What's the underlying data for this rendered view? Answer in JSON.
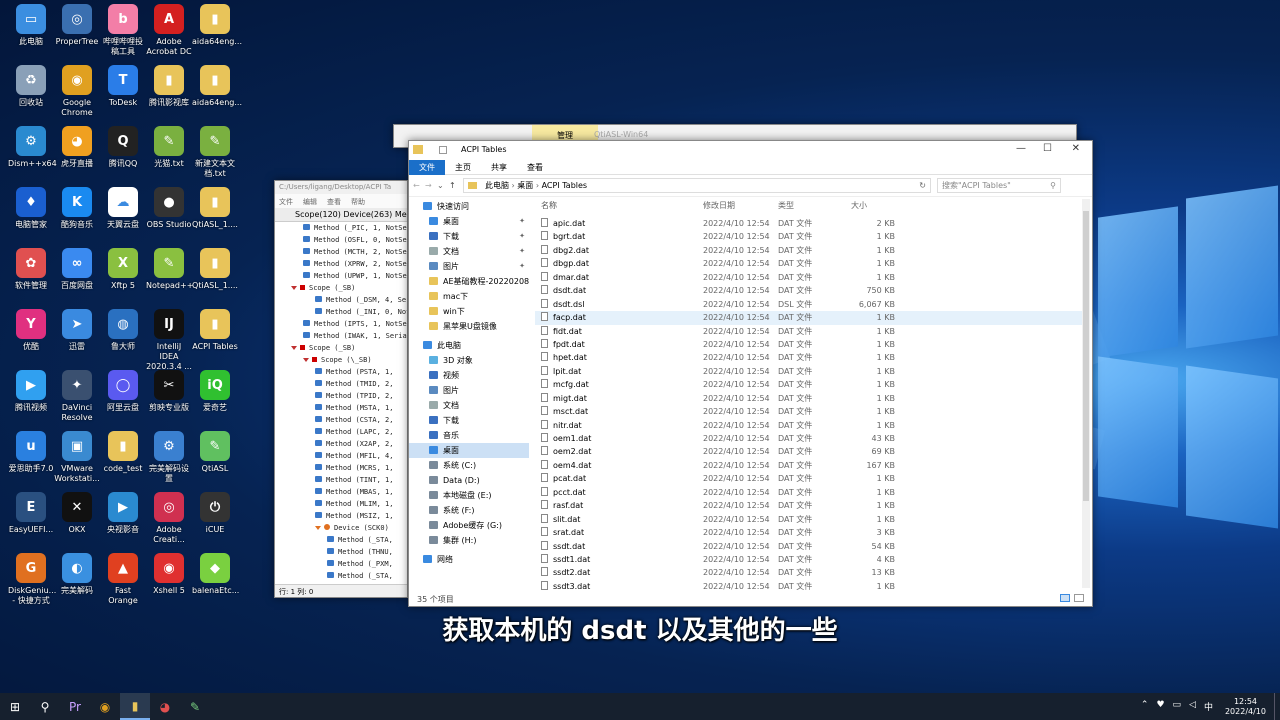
{
  "desktop_icons": [
    {
      "label": "此电脑",
      "color": "#3b8ee0",
      "glyph": "▭"
    },
    {
      "label": "ProperTree",
      "color": "#3a6fb0",
      "glyph": "◎"
    },
    {
      "label": "哔哩哔哩投稿工具",
      "color": "#f37ea7",
      "glyph": "b"
    },
    {
      "label": "Adobe Acrobat DC",
      "color": "#d42020",
      "glyph": "A"
    },
    {
      "label": "aida64eng...",
      "color": "#e8c45a",
      "glyph": "▮"
    },
    {
      "label": "回收站",
      "color": "#8aa0b8",
      "glyph": "♻"
    },
    {
      "label": "Google Chrome",
      "color": "#e0a020",
      "glyph": "◉"
    },
    {
      "label": "ToDesk",
      "color": "#2a7de8",
      "glyph": "T"
    },
    {
      "label": "腾讯影视库",
      "color": "#e8c45a",
      "glyph": "▮"
    },
    {
      "label": "aida64eng...",
      "color": "#e8c45a",
      "glyph": "▮"
    },
    {
      "label": "Dism++x64",
      "color": "#2a8ad0",
      "glyph": "⚙"
    },
    {
      "label": "虎牙直播",
      "color": "#f0a020",
      "glyph": "◕"
    },
    {
      "label": "腾讯QQ",
      "color": "#222",
      "glyph": "Q"
    },
    {
      "label": "光猫.txt",
      "color": "#7ab040",
      "glyph": "✎"
    },
    {
      "label": "新建文本文档.txt",
      "color": "#7ab040",
      "glyph": "✎"
    },
    {
      "label": "电脑管家",
      "color": "#1a5fd0",
      "glyph": "♦"
    },
    {
      "label": "酷狗音乐",
      "color": "#1a8af0",
      "glyph": "K"
    },
    {
      "label": "天翼云盘",
      "color": "#fff",
      "glyph": "☁"
    },
    {
      "label": "OBS Studio",
      "color": "#333",
      "glyph": "●"
    },
    {
      "label": "QtiASL_1....",
      "color": "#e8c45a",
      "glyph": "▮"
    },
    {
      "label": "软件管理",
      "color": "#e05050",
      "glyph": "✿"
    },
    {
      "label": "百度网盘",
      "color": "#3a8af0",
      "glyph": "∞"
    },
    {
      "label": "Xftp 5",
      "color": "#8ac040",
      "glyph": "X"
    },
    {
      "label": "Notepad++",
      "color": "#8ac040",
      "glyph": "✎"
    },
    {
      "label": "QtiASL_1....",
      "color": "#e8c45a",
      "glyph": "▮"
    },
    {
      "label": "优酷",
      "color": "#e03080",
      "glyph": "Y"
    },
    {
      "label": "迅雷",
      "color": "#3a8ae0",
      "glyph": "➤"
    },
    {
      "label": "鲁大师",
      "color": "#2a70c0",
      "glyph": "◍"
    },
    {
      "label": "IntelliJ IDEA 2020.3.4 ...",
      "color": "#111",
      "glyph": "IJ"
    },
    {
      "label": "ACPI Tables",
      "color": "#e8c45a",
      "glyph": "▮"
    },
    {
      "label": "腾讯视频",
      "color": "#30a0f0",
      "glyph": "▶"
    },
    {
      "label": "DaVinci Resolve",
      "color": "#3a5070",
      "glyph": "✦"
    },
    {
      "label": "阿里云盘",
      "color": "#5a5af0",
      "glyph": "◯"
    },
    {
      "label": "剪映专业版",
      "color": "#111",
      "glyph": "✂"
    },
    {
      "label": "爱奇艺",
      "color": "#30c030",
      "glyph": "iQ"
    },
    {
      "label": "爱思助手7.0",
      "color": "#2a80e0",
      "glyph": "u"
    },
    {
      "label": "VMware Workstati...",
      "color": "#3a8ad0",
      "glyph": "▣"
    },
    {
      "label": "code_test",
      "color": "#e8c45a",
      "glyph": "▮"
    },
    {
      "label": "完美解码设置",
      "color": "#3a80d0",
      "glyph": "⚙"
    },
    {
      "label": "QtiASL",
      "color": "#60c060",
      "glyph": "✎"
    },
    {
      "label": "EasyUEFI...",
      "color": "#2a5080",
      "glyph": "E"
    },
    {
      "label": "OKX",
      "color": "#111",
      "glyph": "✕"
    },
    {
      "label": "央视影音",
      "color": "#2a8ad0",
      "glyph": "▶"
    },
    {
      "label": "Adobe Creati...",
      "color": "#d03050",
      "glyph": "◎"
    },
    {
      "label": "iCUE",
      "color": "#333",
      "glyph": "⏻"
    },
    {
      "label": "DiskGeniu... - 快捷方式",
      "color": "#e07020",
      "glyph": "G"
    },
    {
      "label": "完美解码",
      "color": "#3a90e0",
      "glyph": "◐"
    },
    {
      "label": "Fast Orange",
      "color": "#e04020",
      "glyph": "▲"
    },
    {
      "label": "Xshell 5",
      "color": "#e03030",
      "glyph": "◉"
    },
    {
      "label": "balenaEtc...",
      "color": "#7ad040",
      "glyph": "◆"
    }
  ],
  "back_window": {
    "tab": "管理",
    "title": "QtiASL-Win64"
  },
  "qtiasl": {
    "title": "C:/Users/ligang/Desktop/ACPI Ta",
    "menu": [
      "文件",
      "编辑",
      "查看",
      "帮助"
    ],
    "tabs": "Scope(120)  Device(263)  Me",
    "tree": [
      {
        "t": "Method (_PIC, 1, NotSer",
        "k": "m",
        "i": 2
      },
      {
        "t": "Method (OSFL, 0, NotSer",
        "k": "m",
        "i": 2
      },
      {
        "t": "Method (MCTH, 2, NotSer",
        "k": "m",
        "i": 2
      },
      {
        "t": "Method (XPRW, 2, NotSer",
        "k": "m",
        "i": 2
      },
      {
        "t": "Method (UPWP, 1, NotSer",
        "k": "m",
        "i": 2
      },
      {
        "t": "Scope (_SB)",
        "k": "s",
        "i": 1
      },
      {
        "t": "Method (_DSM, 4, Ser",
        "k": "m",
        "i": 3
      },
      {
        "t": "Method (_INI, 0, Not",
        "k": "m",
        "i": 3
      },
      {
        "t": "Method (IPTS, 1, NotSer",
        "k": "m",
        "i": 2
      },
      {
        "t": "Method (IWAK, 1, Serial",
        "k": "m",
        "i": 2
      },
      {
        "t": "Scope (_SB)",
        "k": "s",
        "i": 1
      },
      {
        "t": "Scope (\\_SB)",
        "k": "s",
        "i": 2
      },
      {
        "t": "Method (PSTA, 1,",
        "k": "m",
        "i": 3
      },
      {
        "t": "Method (TMID, 2,",
        "k": "m",
        "i": 3
      },
      {
        "t": "Method (TPID, 2,",
        "k": "m",
        "i": 3
      },
      {
        "t": "Method (MSTA, 1,",
        "k": "m",
        "i": 3
      },
      {
        "t": "Method (CSTA, 2,",
        "k": "m",
        "i": 3
      },
      {
        "t": "Method (LAPC, 2,",
        "k": "m",
        "i": 3
      },
      {
        "t": "Method (X2AP, 2,",
        "k": "m",
        "i": 3
      },
      {
        "t": "Method (MFIL, 4,",
        "k": "m",
        "i": 3
      },
      {
        "t": "Method (MCRS, 1,",
        "k": "m",
        "i": 3
      },
      {
        "t": "Method (TINT, 1,",
        "k": "m",
        "i": 3
      },
      {
        "t": "Method (MBAS, 1,",
        "k": "m",
        "i": 3
      },
      {
        "t": "Method (MLIM, 1,",
        "k": "m",
        "i": 3
      },
      {
        "t": "Method (MSIZ, 1,",
        "k": "m",
        "i": 3
      },
      {
        "t": "Device (SCK0)",
        "k": "d",
        "i": 3
      },
      {
        "t": "Method (_STA,",
        "k": "m",
        "i": 4
      },
      {
        "t": "Method (THNU,",
        "k": "m",
        "i": 4
      },
      {
        "t": "Method (_PXM,",
        "k": "m",
        "i": 4
      },
      {
        "t": "Method (_STA,",
        "k": "m",
        "i": 4
      }
    ],
    "status": "行: 1   列: 0"
  },
  "explorer": {
    "title": "ACPI Tables",
    "ribbon": [
      "文件",
      "主页",
      "共享",
      "查看"
    ],
    "breadcrumb": [
      "此电脑",
      "桌面",
      "ACPI Tables"
    ],
    "search_placeholder": "搜索\"ACPI Tables\"",
    "columns": [
      "名称",
      "修改日期",
      "类型",
      "大小"
    ],
    "nav": [
      {
        "label": "快速访问",
        "color": "#3a8ae0",
        "pin": false,
        "sel": false,
        "i": 0
      },
      {
        "label": "桌面",
        "color": "#3a8ae0",
        "pin": true,
        "sel": false,
        "i": 1
      },
      {
        "label": "下载",
        "color": "#3a70c0",
        "pin": true,
        "sel": false,
        "i": 1
      },
      {
        "label": "文档",
        "color": "#9aa",
        "pin": true,
        "sel": false,
        "i": 1
      },
      {
        "label": "图片",
        "color": "#5a8ac0",
        "pin": true,
        "sel": false,
        "i": 1
      },
      {
        "label": "AE基础教程-20220208",
        "color": "#e8c45a",
        "pin": false,
        "sel": false,
        "i": 1
      },
      {
        "label": "mac下",
        "color": "#e8c45a",
        "pin": false,
        "sel": false,
        "i": 1
      },
      {
        "label": "win下",
        "color": "#e8c45a",
        "pin": false,
        "sel": false,
        "i": 1
      },
      {
        "label": "黑苹果U盘镜像",
        "color": "#e8c45a",
        "pin": false,
        "sel": false,
        "i": 1
      },
      {
        "label": "此电脑",
        "color": "#3a8ae0",
        "pin": false,
        "sel": false,
        "i": 0
      },
      {
        "label": "3D 对象",
        "color": "#5ab0e0",
        "pin": false,
        "sel": false,
        "i": 1
      },
      {
        "label": "视频",
        "color": "#3a70c0",
        "pin": false,
        "sel": false,
        "i": 1
      },
      {
        "label": "图片",
        "color": "#5a8ac0",
        "pin": false,
        "sel": false,
        "i": 1
      },
      {
        "label": "文档",
        "color": "#9aa",
        "pin": false,
        "sel": false,
        "i": 1
      },
      {
        "label": "下载",
        "color": "#3a70c0",
        "pin": false,
        "sel": false,
        "i": 1
      },
      {
        "label": "音乐",
        "color": "#3a70c0",
        "pin": false,
        "sel": false,
        "i": 1
      },
      {
        "label": "桌面",
        "color": "#3a8ae0",
        "pin": false,
        "sel": true,
        "i": 1
      },
      {
        "label": "系统 (C:)",
        "color": "#7a8a9a",
        "pin": false,
        "sel": false,
        "i": 1
      },
      {
        "label": "Data (D:)",
        "color": "#7a8a9a",
        "pin": false,
        "sel": false,
        "i": 1
      },
      {
        "label": "本地磁盘 (E:)",
        "color": "#7a8a9a",
        "pin": false,
        "sel": false,
        "i": 1
      },
      {
        "label": "系统 (F:)",
        "color": "#7a8a9a",
        "pin": false,
        "sel": false,
        "i": 1
      },
      {
        "label": "Adobe缓存 (G:)",
        "color": "#7a8a9a",
        "pin": false,
        "sel": false,
        "i": 1
      },
      {
        "label": "集群 (H:)",
        "color": "#7a8a9a",
        "pin": false,
        "sel": false,
        "i": 1
      },
      {
        "label": "网络",
        "color": "#3a8ae0",
        "pin": false,
        "sel": false,
        "i": 0
      }
    ],
    "files": [
      [
        "apic.dat",
        "2022/4/10 12:54",
        "DAT 文件",
        "2 KB"
      ],
      [
        "bgrt.dat",
        "2022/4/10 12:54",
        "DAT 文件",
        "1 KB"
      ],
      [
        "dbg2.dat",
        "2022/4/10 12:54",
        "DAT 文件",
        "1 KB"
      ],
      [
        "dbgp.dat",
        "2022/4/10 12:54",
        "DAT 文件",
        "1 KB"
      ],
      [
        "dmar.dat",
        "2022/4/10 12:54",
        "DAT 文件",
        "1 KB"
      ],
      [
        "dsdt.dat",
        "2022/4/10 12:54",
        "DAT 文件",
        "750 KB"
      ],
      [
        "dsdt.dsl",
        "2022/4/10 12:54",
        "DSL 文件",
        "6,067 KB"
      ],
      [
        "facp.dat",
        "2022/4/10 12:54",
        "DAT 文件",
        "1 KB"
      ],
      [
        "fidt.dat",
        "2022/4/10 12:54",
        "DAT 文件",
        "1 KB"
      ],
      [
        "fpdt.dat",
        "2022/4/10 12:54",
        "DAT 文件",
        "1 KB"
      ],
      [
        "hpet.dat",
        "2022/4/10 12:54",
        "DAT 文件",
        "1 KB"
      ],
      [
        "lpit.dat",
        "2022/4/10 12:54",
        "DAT 文件",
        "1 KB"
      ],
      [
        "mcfg.dat",
        "2022/4/10 12:54",
        "DAT 文件",
        "1 KB"
      ],
      [
        "migt.dat",
        "2022/4/10 12:54",
        "DAT 文件",
        "1 KB"
      ],
      [
        "msct.dat",
        "2022/4/10 12:54",
        "DAT 文件",
        "1 KB"
      ],
      [
        "nitr.dat",
        "2022/4/10 12:54",
        "DAT 文件",
        "1 KB"
      ],
      [
        "oem1.dat",
        "2022/4/10 12:54",
        "DAT 文件",
        "43 KB"
      ],
      [
        "oem2.dat",
        "2022/4/10 12:54",
        "DAT 文件",
        "69 KB"
      ],
      [
        "oem4.dat",
        "2022/4/10 12:54",
        "DAT 文件",
        "167 KB"
      ],
      [
        "pcat.dat",
        "2022/4/10 12:54",
        "DAT 文件",
        "1 KB"
      ],
      [
        "pcct.dat",
        "2022/4/10 12:54",
        "DAT 文件",
        "1 KB"
      ],
      [
        "rasf.dat",
        "2022/4/10 12:54",
        "DAT 文件",
        "1 KB"
      ],
      [
        "slit.dat",
        "2022/4/10 12:54",
        "DAT 文件",
        "1 KB"
      ],
      [
        "srat.dat",
        "2022/4/10 12:54",
        "DAT 文件",
        "3 KB"
      ],
      [
        "ssdt.dat",
        "2022/4/10 12:54",
        "DAT 文件",
        "54 KB"
      ],
      [
        "ssdt1.dat",
        "2022/4/10 12:54",
        "DAT 文件",
        "4 KB"
      ],
      [
        "ssdt2.dat",
        "2022/4/10 12:54",
        "DAT 文件",
        "13 KB"
      ],
      [
        "ssdt3.dat",
        "2022/4/10 12:54",
        "DAT 文件",
        "1 KB"
      ]
    ],
    "highlighted": "facp.dat",
    "status": "35 个项目"
  },
  "subtitle": "获取本机的 dsdt 以及其他的一些",
  "taskbar": {
    "apps": [
      {
        "g": "⊞",
        "c": "#fff"
      },
      {
        "g": "⚲",
        "c": "#fff"
      },
      {
        "g": "Pr",
        "c": "#c8a0ff"
      },
      {
        "g": "◉",
        "c": "#e0a020"
      },
      {
        "g": "▮",
        "c": "#e8c45a"
      },
      {
        "g": "◕",
        "c": "#e05050"
      },
      {
        "g": "✎",
        "c": "#7ad080"
      }
    ],
    "tray": [
      "⌃",
      "♥",
      "▭",
      "◁",
      "中"
    ],
    "time": "12:54",
    "date": "2022/4/10"
  }
}
